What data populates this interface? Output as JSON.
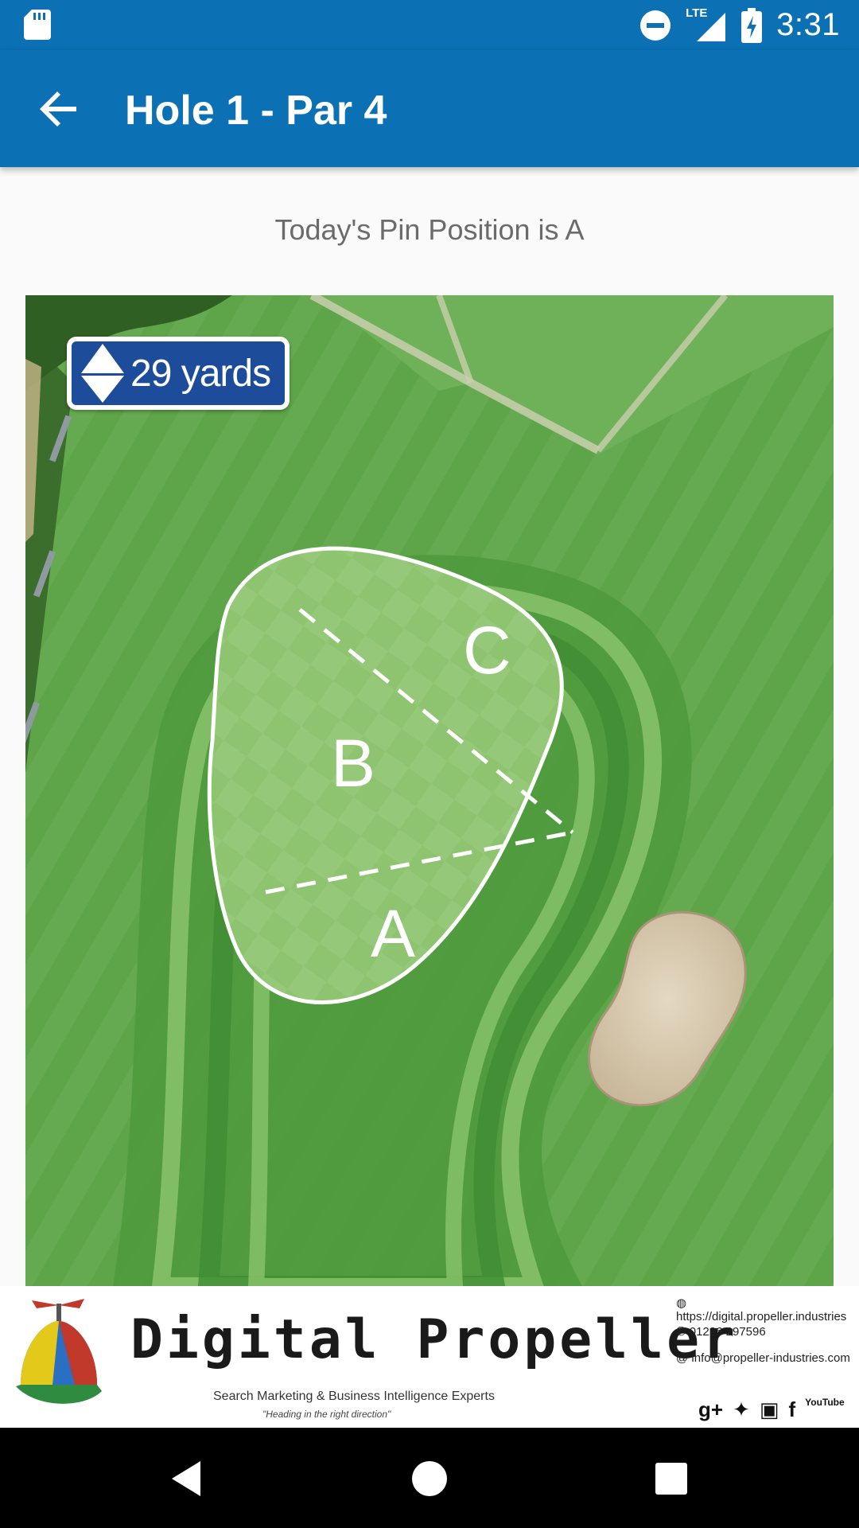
{
  "status_bar": {
    "time": "3:31",
    "network": "LTE",
    "icons": [
      "sd-card-icon",
      "dnd-icon",
      "signal-icon",
      "battery-charging-icon"
    ]
  },
  "app_bar": {
    "title": "Hole 1 - Par 4",
    "back_icon": "arrow-back-icon"
  },
  "pin_message": "Today's Pin Position is A",
  "map": {
    "yardage": "29 yards",
    "zones": [
      "A",
      "B",
      "C"
    ]
  },
  "banner": {
    "brand": "Digital Propeller",
    "tagline": "Search Marketing & Business Intelligence Experts",
    "motto": "\"Heading in the right direction\"",
    "website": "https://digital.propeller.industries",
    "phone": "01226 297596",
    "email": "info@propeller-industries.com",
    "social": [
      "g+",
      "twitter",
      "instagram",
      "f",
      "YouTube"
    ]
  },
  "nav_bar": {
    "buttons": [
      "back-nav-icon",
      "home-nav-icon",
      "recents-nav-icon"
    ]
  }
}
